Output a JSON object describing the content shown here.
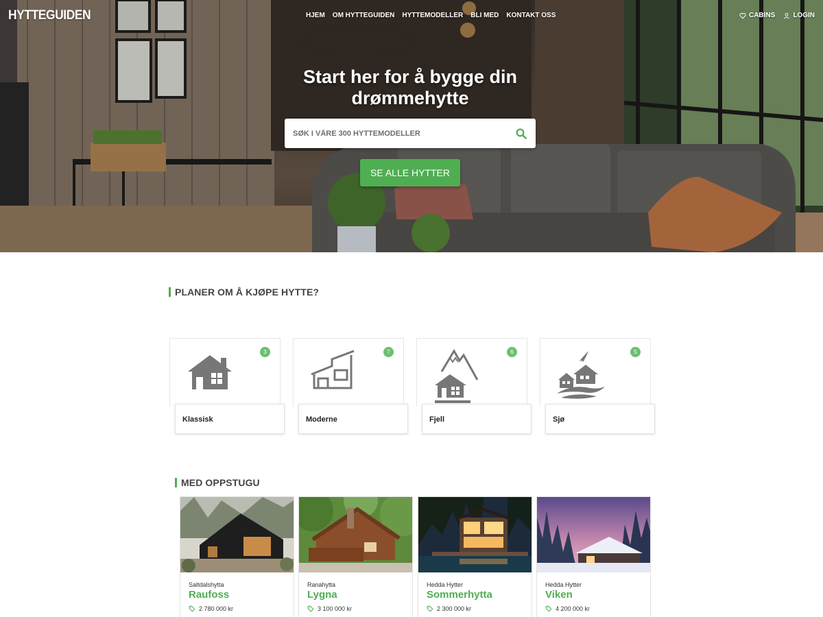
{
  "brand": {
    "logo": "HYTTEGUIDEN",
    "accent": "#4fae52"
  },
  "nav": {
    "items": [
      "HJEM",
      "OM HYTTEGUIDEN",
      "HYTTEMODELLER",
      "BLI MED",
      "KONTAKT OSS"
    ],
    "cabins": "CABINS",
    "login": "LOGIN"
  },
  "hero": {
    "title": "Start her for å bygge din drømmehytte",
    "search_placeholder": "SØK I VÅRE 300 HYTTEMODELLER",
    "cta": "SE ALLE HYTTER"
  },
  "categories": {
    "heading": "PLANER OM Å KJØPE HYTTE?",
    "items": [
      {
        "label": "Klassisk",
        "count": "3",
        "icon": "classic-house-icon"
      },
      {
        "label": "Moderne",
        "count": "7",
        "icon": "modern-house-icon"
      },
      {
        "label": "Fjell",
        "count": "6",
        "icon": "mountain-house-icon"
      },
      {
        "label": "Sjø",
        "count": "5",
        "icon": "sea-house-icon"
      }
    ]
  },
  "featured": {
    "heading": "MED OPPSTUGU",
    "cabins": [
      {
        "maker": "Saltdalshytta",
        "name": "Raufoss",
        "price": "2 780 000 kr"
      },
      {
        "maker": "Ranahytta",
        "name": "Lygna",
        "price": "3 100 000 kr"
      },
      {
        "maker": "Hedda Hytter",
        "name": "Sommerhytta",
        "price": "2 300 000 kr"
      },
      {
        "maker": "Hedda Hytter",
        "name": "Viken",
        "price": "4 200 000 kr"
      }
    ]
  }
}
